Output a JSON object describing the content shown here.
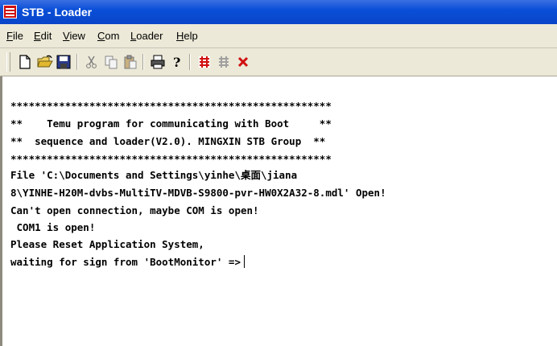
{
  "window": {
    "title": "STB - Loader"
  },
  "menu": [
    {
      "pre": "",
      "u": "F",
      "post": "ile"
    },
    {
      "pre": "",
      "u": "E",
      "post": "dit"
    },
    {
      "pre": "",
      "u": "V",
      "post": "iew"
    },
    {
      "pre": "",
      "u": "C",
      "post": "om"
    },
    {
      "pre": "",
      "u": "L",
      "post": "oader"
    },
    {
      "pre": "",
      "u": "H",
      "post": "elp"
    }
  ],
  "toolbar": {
    "icons": [
      "new-file-icon",
      "open-folder-icon",
      "save-icon",
      "cut-icon",
      "copy-icon",
      "paste-icon",
      "print-icon",
      "help-icon",
      "connect-icon",
      "disconnect-icon",
      "close-x-icon"
    ]
  },
  "terminal": {
    "lines": [
      "*****************************************************",
      "**    Temu program for communicating with Boot     **",
      "**  sequence and loader(V2.0). MINGXIN STB Group  **",
      "*****************************************************",
      "File 'C:\\Documents and Settings\\yinhe\\桌面\\jiana",
      "8\\YINHE-H20M-dvbs-MultiTV-MDVB-S9800-pvr-HW0X2A32-8.mdl' Open!",
      "Can't open connection, maybe COM is open!",
      " COM1 is open!",
      "Please Reset Application System,",
      "waiting for sign from 'BootMonitor' =>"
    ]
  },
  "colors": {
    "titlebar": "#0a4fd8",
    "menubar": "#ece9d8",
    "accent_red": "#d01010"
  }
}
